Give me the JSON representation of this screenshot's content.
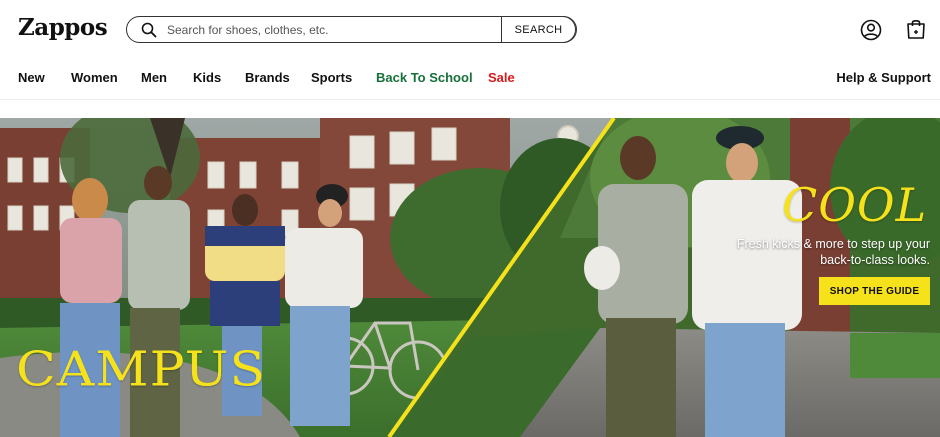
{
  "brand": {
    "logo_text": "Zappos"
  },
  "search": {
    "placeholder": "Search for shoes, clothes, etc.",
    "value": "",
    "button_label": "SEARCH",
    "icon": "search-icon"
  },
  "header_icons": {
    "account": "user-circle-icon",
    "cart": "shopping-bag-icon"
  },
  "nav": {
    "items": [
      {
        "label": "New"
      },
      {
        "label": "Women"
      },
      {
        "label": "Men"
      },
      {
        "label": "Kids"
      },
      {
        "label": "Brands"
      },
      {
        "label": "Sports"
      },
      {
        "label": "Back To School",
        "color": "#17703a"
      },
      {
        "label": "Sale",
        "color": "#d81b1b"
      }
    ],
    "help_label": "Help & Support"
  },
  "hero": {
    "left_headline": "CAMPUS",
    "right_headline": "COOL",
    "subtext": "Fresh kicks & more to step up your back-to-class looks.",
    "cta_label": "SHOP THE GUIDE",
    "accent_color": "#f6e21a"
  }
}
